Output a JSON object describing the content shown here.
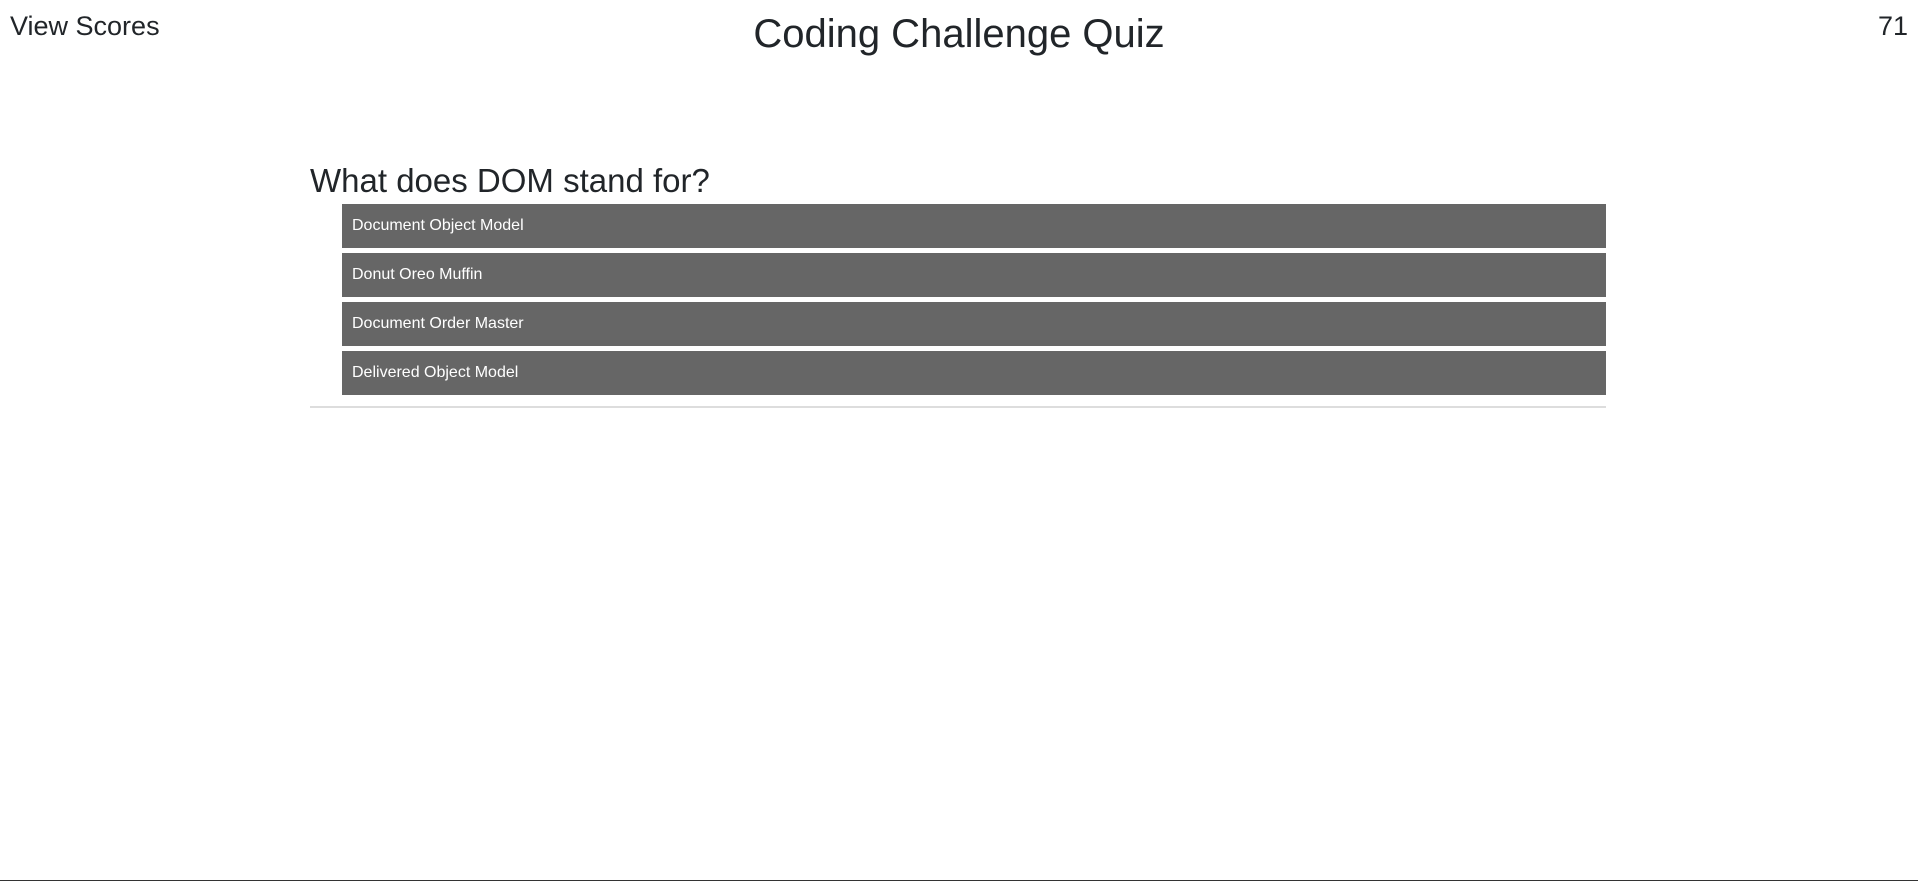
{
  "header": {
    "view_scores_label": "View Scores",
    "title": "Coding Challenge Quiz",
    "timer": "71"
  },
  "quiz": {
    "question": "What does DOM stand for?",
    "answers": [
      "Document Object Model",
      "Donut Oreo Muffin",
      "Document Order Master",
      "Delivered Object Model"
    ]
  },
  "colors": {
    "answer_background": "#666666",
    "answer_text": "#ffffff",
    "text": "#212529",
    "divider": "#dddddd"
  }
}
